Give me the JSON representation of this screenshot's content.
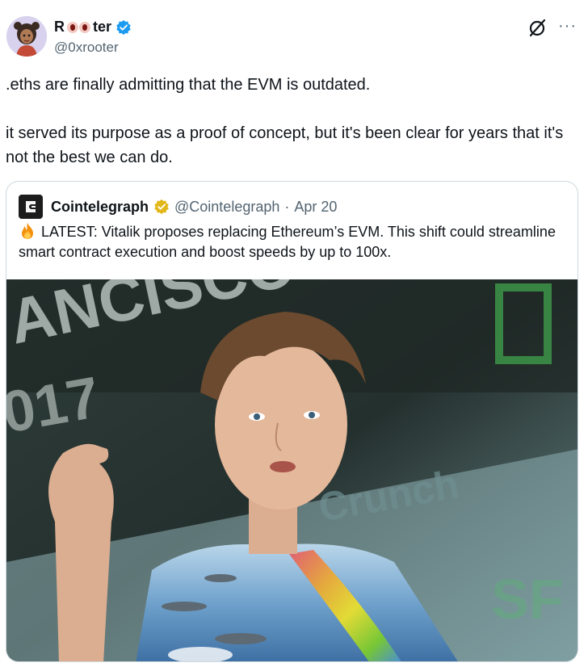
{
  "author": {
    "name_prefix": "R",
    "name_suffix": "ter",
    "handle": "@0xrooter",
    "verified": true,
    "avatar": "cartoon-avatar",
    "eyes_emoji": "eyes-emoji"
  },
  "header_icons": {
    "grok": "grok-icon",
    "more": "···"
  },
  "tweet": {
    "line1": ".eths are finally admitting that the EVM is outdated.",
    "line2": "it served its purpose as a proof of concept, but it's been clear for years that it's not the best we can do."
  },
  "quote": {
    "name": "Cointelegraph",
    "verified_badge": "gold",
    "handle": "@Cointelegraph",
    "separator": "·",
    "date": "Apr 20",
    "text": "LATEST: Vitalik proposes replacing Ethereum’s EVM. This shift could streamline smart contract execution and boost speeds by up to 100x.",
    "emoji": "fire-emoji",
    "image": "photo-of-speaker-on-stage"
  },
  "colors": {
    "text": "#0f1419",
    "secondary": "#536471",
    "border": "#cfd9de",
    "verified_blue": "#1d9bf0",
    "verified_gold": "#e2b719"
  }
}
